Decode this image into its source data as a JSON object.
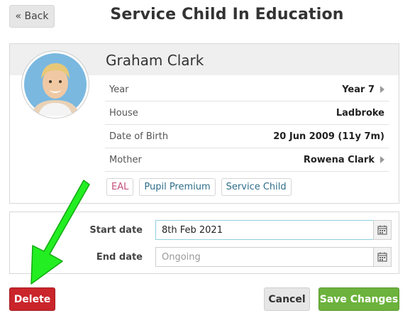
{
  "header": {
    "back_label": "« Back",
    "title": "Service Child In Education"
  },
  "student": {
    "name": "Graham Clark",
    "details": [
      {
        "label": "Year",
        "value": "Year 7",
        "has_link": true
      },
      {
        "label": "House",
        "value": "Ladbroke",
        "has_link": false
      },
      {
        "label": "Date of Birth",
        "value": "20 Jun 2009 (11y 7m)",
        "has_link": false
      },
      {
        "label": "Mother",
        "value": "Rowena Clark",
        "has_link": true
      }
    ],
    "tags": [
      "EAL",
      "Pupil Premium",
      "Service Child"
    ]
  },
  "form": {
    "start_label": "Start date",
    "start_value": "8th Feb 2021",
    "end_label": "End date",
    "end_placeholder": "Ongoing"
  },
  "actions": {
    "delete_label": "Delete",
    "cancel_label": "Cancel",
    "save_label": "Save Changes"
  },
  "colors": {
    "delete": "#c9252b",
    "save": "#6cb23c",
    "annotation_arrow": "#22ee22"
  },
  "icons": {
    "calendar": "calendar-icon",
    "row_link": "chevron-right-icon",
    "annotation": "green-arrow-icon"
  }
}
